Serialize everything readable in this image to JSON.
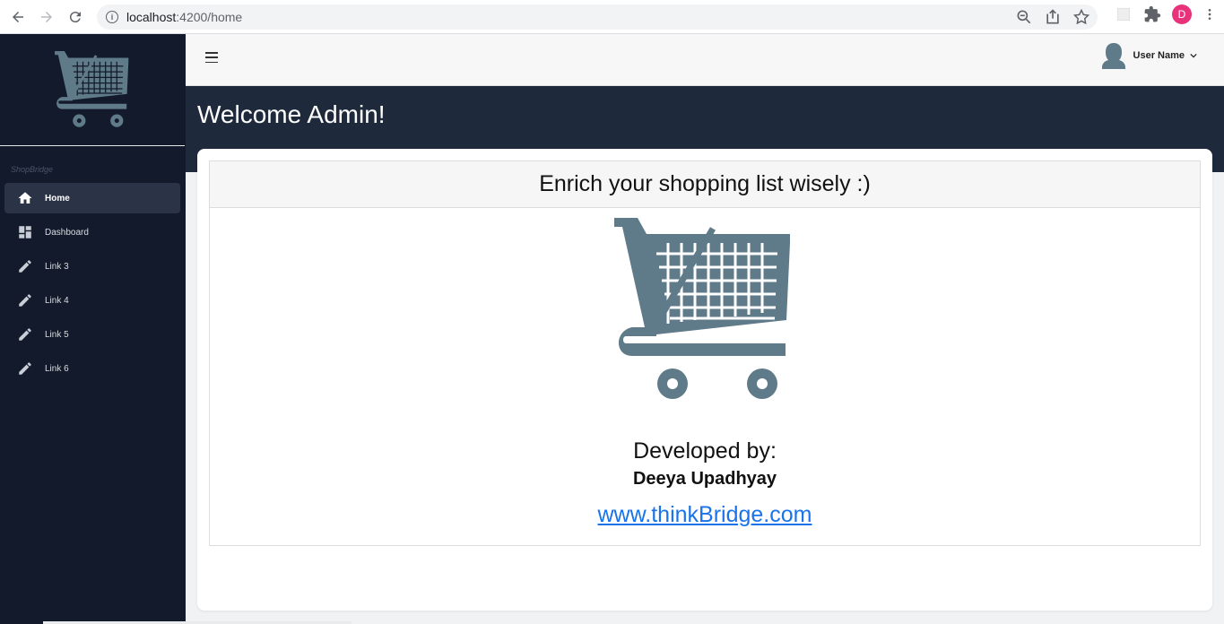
{
  "browser": {
    "url_host": "localhost",
    "url_path": ":4200/home",
    "profile_initial": "D"
  },
  "sidebar": {
    "brand": "ShopBridge",
    "items": [
      {
        "label": "Home",
        "icon": "home-icon",
        "active": true
      },
      {
        "label": "Dashboard",
        "icon": "dashboard-icon",
        "active": false
      },
      {
        "label": "Link 3",
        "icon": "pencil-icon",
        "active": false
      },
      {
        "label": "Link 4",
        "icon": "pencil-icon",
        "active": false
      },
      {
        "label": "Link 5",
        "icon": "pencil-icon",
        "active": false
      },
      {
        "label": "Link 6",
        "icon": "pencil-icon",
        "active": false
      }
    ]
  },
  "header": {
    "user_name": "User Name"
  },
  "banner": {
    "title": "Welcome Admin!"
  },
  "card": {
    "heading": "Enrich your shopping list wisely :)",
    "developed_by": "Developed by:",
    "developer": "Deeya Upadhyay",
    "link": "www.thinkBridge.com"
  },
  "colors": {
    "sidebar_bg": "#121a2b",
    "banner_bg": "#1e2a3c",
    "cart": "#5f7a88",
    "link": "#1a73e8",
    "profile": "#e8337a"
  }
}
